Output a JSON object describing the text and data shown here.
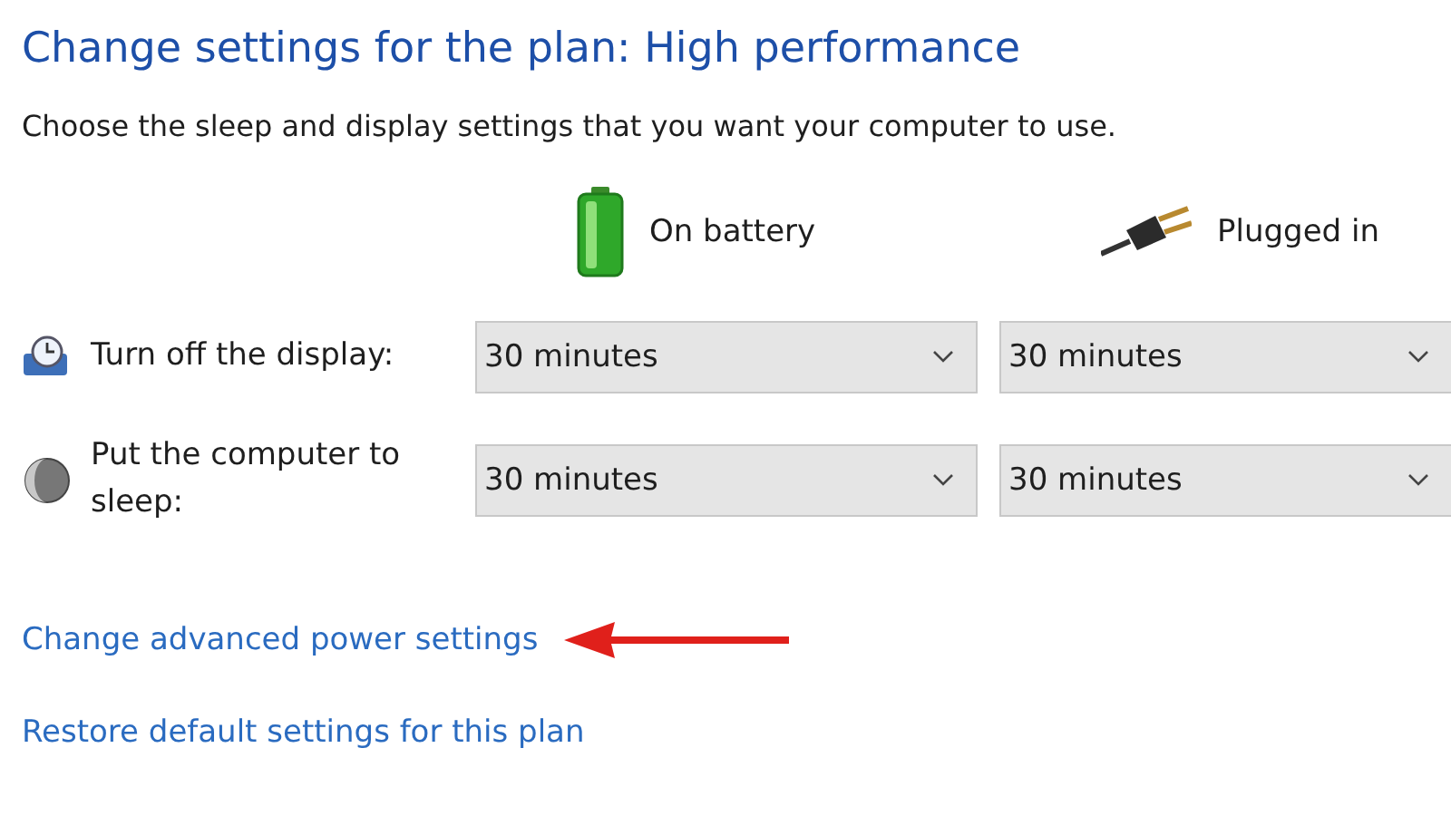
{
  "title": "Change settings for the plan: High performance",
  "subtitle": "Choose the sleep and display settings that you want your computer to use.",
  "columns": [
    {
      "kind": "battery",
      "label": "On battery"
    },
    {
      "kind": "plug",
      "label": "Plugged in"
    }
  ],
  "settings": [
    {
      "kind": "display",
      "label": "Turn off the display:",
      "values": [
        "30 minutes",
        "30 minutes"
      ]
    },
    {
      "kind": "sleep",
      "label": "Put the computer to sleep:",
      "values": [
        "30 minutes",
        "30 minutes"
      ]
    }
  ],
  "links": [
    "Change advanced power settings",
    "Restore default settings for this plan"
  ]
}
